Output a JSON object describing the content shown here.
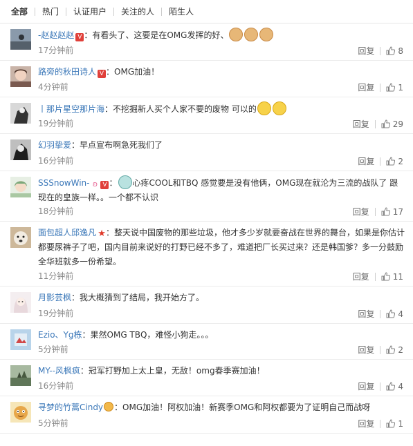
{
  "tabs": [
    "全部",
    "热门",
    "认证用户",
    "关注的人",
    "陌生人"
  ],
  "reply_label": "回复",
  "comments": [
    {
      "user": "-赵赵赵赵",
      "text": "：有看头了、这要是在OMG发挥的好、",
      "time": "17分钟前",
      "likes": "8"
    },
    {
      "user": "路旁的秋田诗人",
      "text": "：OMG加油！",
      "time": "4分钟前",
      "likes": "1"
    },
    {
      "user": "丨那片星空那片海",
      "text": "：不挖掘新人买个人家不要的废物 可以的",
      "time": "19分钟前",
      "likes": "29"
    },
    {
      "user": "幻羽挚爱",
      "text": "：早点宣布啊急死我们了",
      "time": "16分钟前",
      "likes": "2"
    },
    {
      "user": "SSSnowWin-",
      "text": "心疼COOL和TBQ 感觉要是没有他俩，OMG现在就沦为三流的战队了 跟现在的皇族一样。。一个都不认识",
      "time": "18分钟前",
      "likes": "17"
    },
    {
      "user": "面包超人邱逸凡",
      "text": "：整天说中国废物的那些垃圾，他才多少岁就要奋战在世界的舞台，如果是你估计都要尿裤子了吧，国内目前来说好的打野已经不多了，难道把厂长买过来？还是韩国爹？多一分鼓励全华班就多一份希望。",
      "time": "11分钟前",
      "likes": "11"
    },
    {
      "user": "月影芸枫",
      "text": "：我大概猜到了结局，我开始方了。",
      "time": "19分钟前",
      "likes": "4"
    },
    {
      "user": "Ezio、Yg栋",
      "text": "：果然OMG TBQ，难怪小狗走。。。",
      "time": "5分钟前",
      "likes": "2"
    },
    {
      "user": "MY--风枫疯",
      "text": "：冠军打野加上太上皇，无敌！omg春季赛加油！",
      "time": "16分钟前",
      "likes": "4"
    },
    {
      "user": "寻梦的竹蒿Cindy",
      "text": "：OMG加油！阿权加油！新赛季OMG和阿权都要为了证明自己而战呀",
      "time": "5分钟前",
      "likes": "1"
    }
  ],
  "footer_text": "…"
}
